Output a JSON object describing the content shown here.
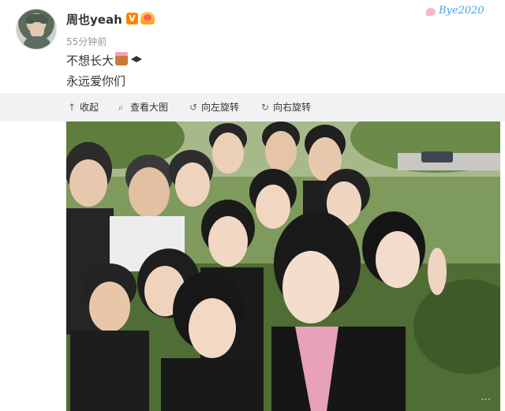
{
  "post": {
    "username": "周也yeah",
    "verified_badge": "V",
    "time": "55分钟前",
    "text_line1": "不想长大",
    "text_line2": "永远爱你们",
    "decoration_text": "Bye2020"
  },
  "toolbar": {
    "collapse": "收起",
    "view_large": "查看大图",
    "rotate_left": "向左旋转",
    "rotate_right": "向右旋转"
  },
  "icons": {
    "collapse": "arrow-up-icon",
    "view_large": "magnifier-icon",
    "rotate_left": "rotate-left-icon",
    "rotate_right": "rotate-right-icon"
  },
  "photo": {
    "watermark": "..."
  },
  "colors": {
    "toolbar_bg": "#f2f2f5",
    "verified": "#ff8200",
    "decoration": "#4aa3e0"
  }
}
